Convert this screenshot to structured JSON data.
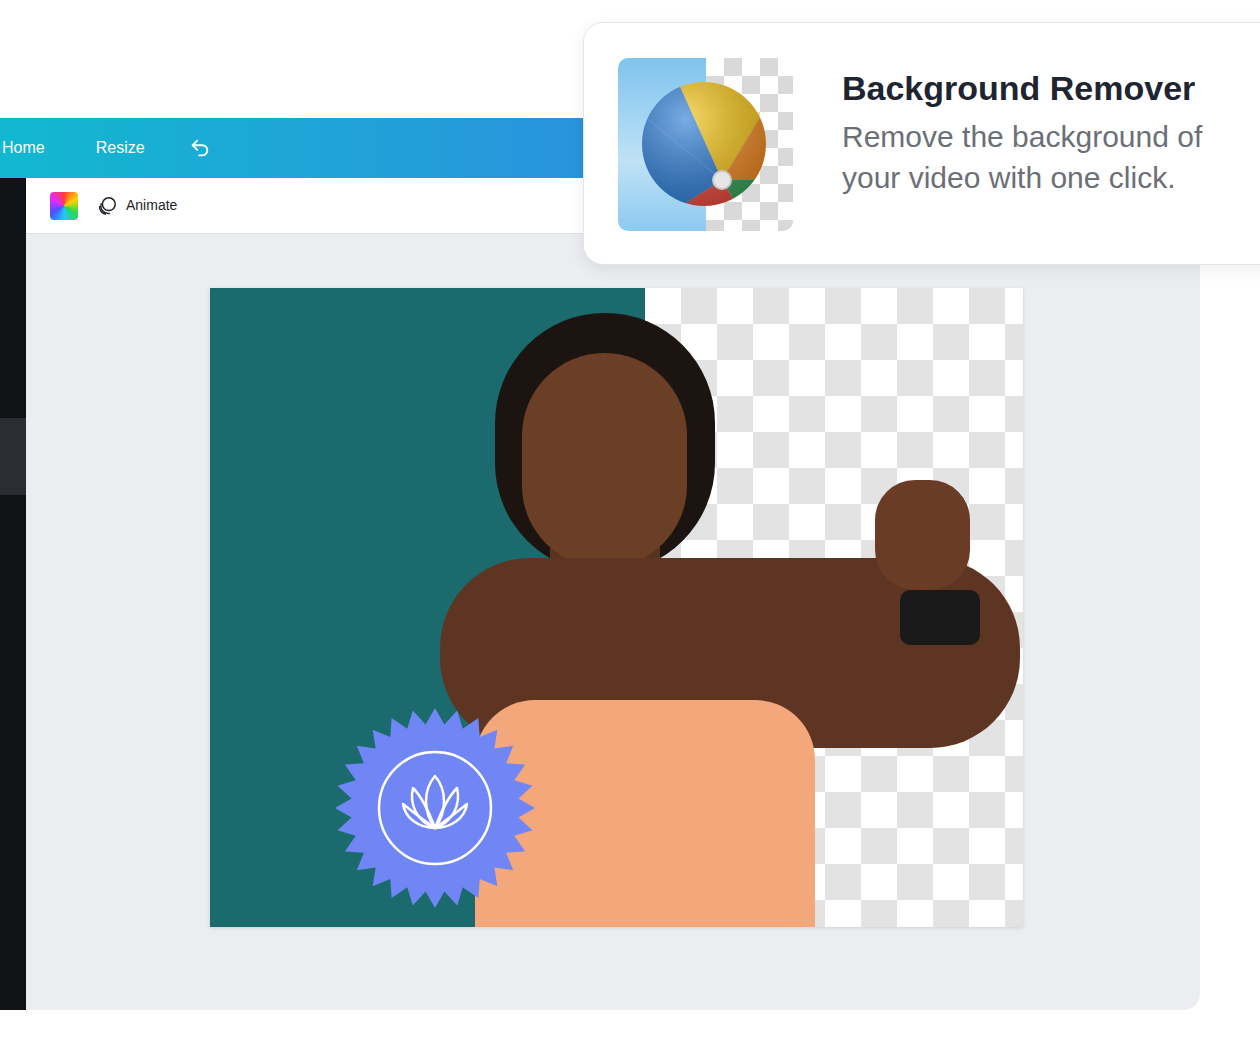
{
  "top_bar": {
    "items": [
      {
        "label": "Home"
      },
      {
        "label": "Resize"
      }
    ]
  },
  "toolbar": {
    "animate_label": "Animate"
  },
  "popup": {
    "title": "Background Remover",
    "description_lines": [
      "Remove the background of",
      "your video with one click."
    ]
  }
}
